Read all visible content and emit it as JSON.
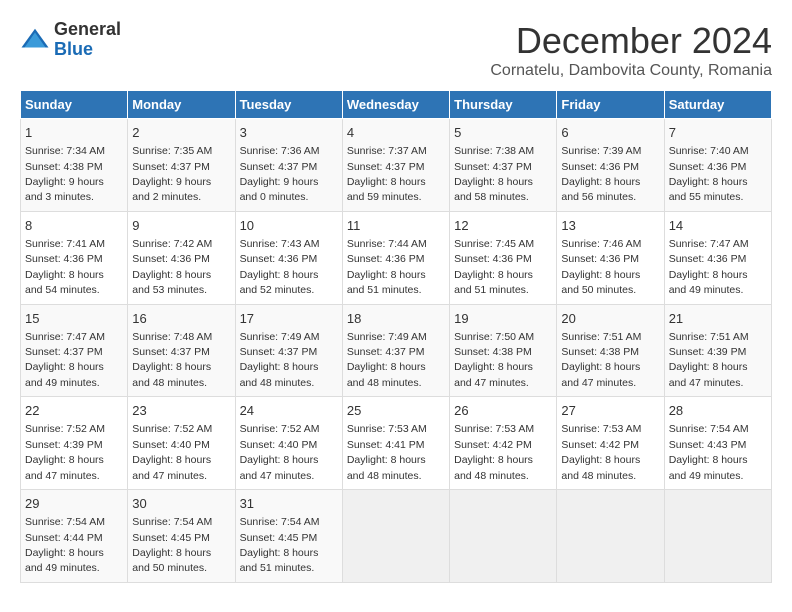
{
  "logo": {
    "general": "General",
    "blue": "Blue"
  },
  "title": "December 2024",
  "subtitle": "Cornatelu, Dambovita County, Romania",
  "calendar": {
    "headers": [
      "Sunday",
      "Monday",
      "Tuesday",
      "Wednesday",
      "Thursday",
      "Friday",
      "Saturday"
    ],
    "weeks": [
      [
        {
          "day": "1",
          "sunrise": "7:34 AM",
          "sunset": "4:38 PM",
          "daylight": "9 hours and 3 minutes."
        },
        {
          "day": "2",
          "sunrise": "7:35 AM",
          "sunset": "4:37 PM",
          "daylight": "9 hours and 2 minutes."
        },
        {
          "day": "3",
          "sunrise": "7:36 AM",
          "sunset": "4:37 PM",
          "daylight": "9 hours and 0 minutes."
        },
        {
          "day": "4",
          "sunrise": "7:37 AM",
          "sunset": "4:37 PM",
          "daylight": "8 hours and 59 minutes."
        },
        {
          "day": "5",
          "sunrise": "7:38 AM",
          "sunset": "4:37 PM",
          "daylight": "8 hours and 58 minutes."
        },
        {
          "day": "6",
          "sunrise": "7:39 AM",
          "sunset": "4:36 PM",
          "daylight": "8 hours and 56 minutes."
        },
        {
          "day": "7",
          "sunrise": "7:40 AM",
          "sunset": "4:36 PM",
          "daylight": "8 hours and 55 minutes."
        }
      ],
      [
        {
          "day": "8",
          "sunrise": "7:41 AM",
          "sunset": "4:36 PM",
          "daylight": "8 hours and 54 minutes."
        },
        {
          "day": "9",
          "sunrise": "7:42 AM",
          "sunset": "4:36 PM",
          "daylight": "8 hours and 53 minutes."
        },
        {
          "day": "10",
          "sunrise": "7:43 AM",
          "sunset": "4:36 PM",
          "daylight": "8 hours and 52 minutes."
        },
        {
          "day": "11",
          "sunrise": "7:44 AM",
          "sunset": "4:36 PM",
          "daylight": "8 hours and 51 minutes."
        },
        {
          "day": "12",
          "sunrise": "7:45 AM",
          "sunset": "4:36 PM",
          "daylight": "8 hours and 51 minutes."
        },
        {
          "day": "13",
          "sunrise": "7:46 AM",
          "sunset": "4:36 PM",
          "daylight": "8 hours and 50 minutes."
        },
        {
          "day": "14",
          "sunrise": "7:47 AM",
          "sunset": "4:36 PM",
          "daylight": "8 hours and 49 minutes."
        }
      ],
      [
        {
          "day": "15",
          "sunrise": "7:47 AM",
          "sunset": "4:37 PM",
          "daylight": "8 hours and 49 minutes."
        },
        {
          "day": "16",
          "sunrise": "7:48 AM",
          "sunset": "4:37 PM",
          "daylight": "8 hours and 48 minutes."
        },
        {
          "day": "17",
          "sunrise": "7:49 AM",
          "sunset": "4:37 PM",
          "daylight": "8 hours and 48 minutes."
        },
        {
          "day": "18",
          "sunrise": "7:49 AM",
          "sunset": "4:37 PM",
          "daylight": "8 hours and 48 minutes."
        },
        {
          "day": "19",
          "sunrise": "7:50 AM",
          "sunset": "4:38 PM",
          "daylight": "8 hours and 47 minutes."
        },
        {
          "day": "20",
          "sunrise": "7:51 AM",
          "sunset": "4:38 PM",
          "daylight": "8 hours and 47 minutes."
        },
        {
          "day": "21",
          "sunrise": "7:51 AM",
          "sunset": "4:39 PM",
          "daylight": "8 hours and 47 minutes."
        }
      ],
      [
        {
          "day": "22",
          "sunrise": "7:52 AM",
          "sunset": "4:39 PM",
          "daylight": "8 hours and 47 minutes."
        },
        {
          "day": "23",
          "sunrise": "7:52 AM",
          "sunset": "4:40 PM",
          "daylight": "8 hours and 47 minutes."
        },
        {
          "day": "24",
          "sunrise": "7:52 AM",
          "sunset": "4:40 PM",
          "daylight": "8 hours and 47 minutes."
        },
        {
          "day": "25",
          "sunrise": "7:53 AM",
          "sunset": "4:41 PM",
          "daylight": "8 hours and 48 minutes."
        },
        {
          "day": "26",
          "sunrise": "7:53 AM",
          "sunset": "4:42 PM",
          "daylight": "8 hours and 48 minutes."
        },
        {
          "day": "27",
          "sunrise": "7:53 AM",
          "sunset": "4:42 PM",
          "daylight": "8 hours and 48 minutes."
        },
        {
          "day": "28",
          "sunrise": "7:54 AM",
          "sunset": "4:43 PM",
          "daylight": "8 hours and 49 minutes."
        }
      ],
      [
        {
          "day": "29",
          "sunrise": "7:54 AM",
          "sunset": "4:44 PM",
          "daylight": "8 hours and 49 minutes."
        },
        {
          "day": "30",
          "sunrise": "7:54 AM",
          "sunset": "4:45 PM",
          "daylight": "8 hours and 50 minutes."
        },
        {
          "day": "31",
          "sunrise": "7:54 AM",
          "sunset": "4:45 PM",
          "daylight": "8 hours and 51 minutes."
        },
        null,
        null,
        null,
        null
      ]
    ]
  }
}
